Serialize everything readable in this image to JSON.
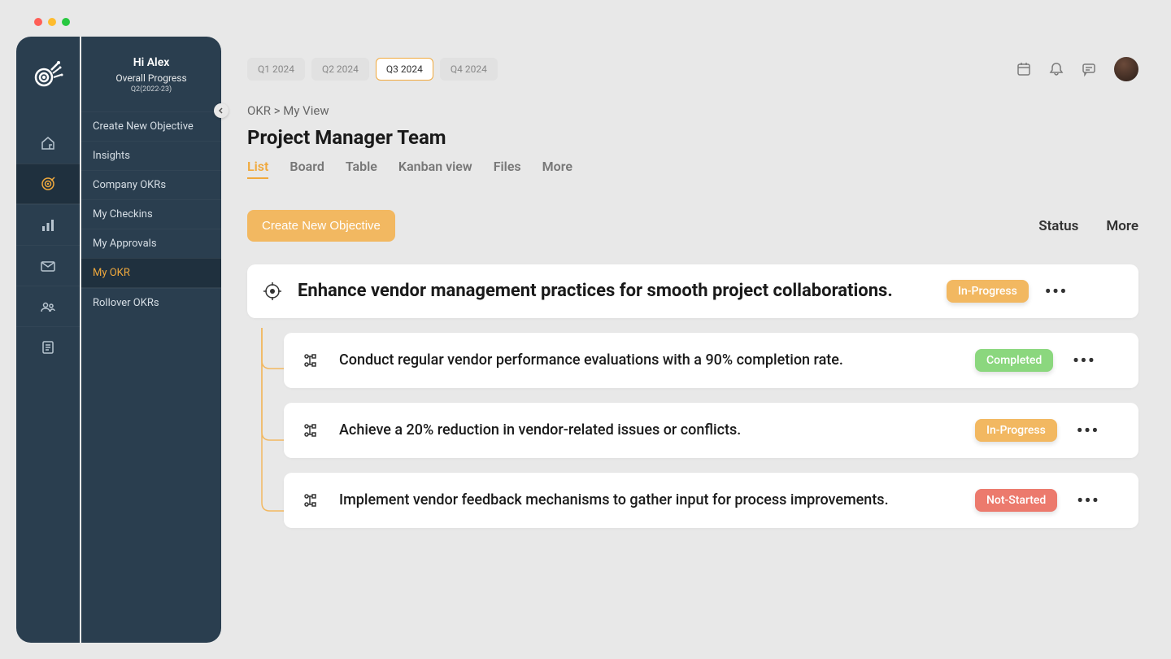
{
  "sidebar": {
    "greeting": "Hi Alex",
    "subtitle": "Overall Progress",
    "small": "Q2(2022-23)",
    "items": [
      {
        "label": "Create New Objective"
      },
      {
        "label": "Insights"
      },
      {
        "label": "Company OKRs"
      },
      {
        "label": "My  Checkins"
      },
      {
        "label": "My Approvals"
      },
      {
        "label": "My OKR"
      },
      {
        "label": "Rollover OKRs"
      }
    ],
    "active_index": 5
  },
  "rail": {
    "icons": [
      "home",
      "target",
      "chart",
      "mail",
      "people",
      "report"
    ],
    "active_index": 1
  },
  "quarters": {
    "items": [
      "Q1 2024",
      "Q2 2024",
      "Q3 2024",
      "Q4 2024"
    ],
    "active_index": 2
  },
  "breadcrumb": "OKR > My View",
  "page_title": "Project Manager Team",
  "view_tabs": {
    "items": [
      "List",
      "Board",
      "Table",
      "Kanban view",
      "Files",
      "More"
    ],
    "active_index": 0
  },
  "cta_label": "Create New Objective",
  "right_controls": {
    "status": "Status",
    "more": "More"
  },
  "objective": {
    "title": "Enhance vendor management practices for smooth project collaborations.",
    "status": "In-Progress",
    "status_class": "badge-progress"
  },
  "key_results": [
    {
      "title": "Conduct regular vendor performance evaluations with a 90% completion rate.",
      "status": "Completed",
      "status_class": "badge-completed"
    },
    {
      "title": "Achieve a 20% reduction in vendor-related issues or conflicts.",
      "status": "In-Progress",
      "status_class": "badge-progress"
    },
    {
      "title": "Implement vendor feedback mechanisms to gather input for process improvements.",
      "status": "Not-Started",
      "status_class": "badge-notstarted"
    }
  ]
}
